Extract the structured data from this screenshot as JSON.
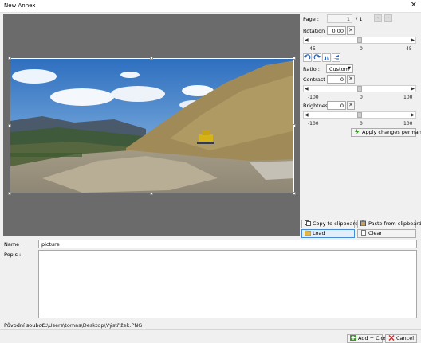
{
  "window": {
    "title": "New Annex",
    "close_glyph": "✕"
  },
  "page": {
    "label": "Page :",
    "current": "1",
    "total": "/ 1",
    "prev": "‹",
    "next": "›"
  },
  "rotation": {
    "label": "Rotation :",
    "value": "0,00",
    "ticks": [
      "-45",
      "0",
      "45"
    ],
    "level": 0
  },
  "transform_icons": [
    "rotate-left-icon",
    "rotate-right-icon",
    "flip-vertical-icon",
    "flip-horizontal-icon"
  ],
  "ratio": {
    "label": "Ratio :",
    "value": "Custom"
  },
  "contrast": {
    "label": "Contrast :",
    "value": "0",
    "ticks": [
      "-100",
      "0",
      "100"
    ],
    "level": 0
  },
  "brightness": {
    "label": "Brightness :",
    "value": "0",
    "ticks": [
      "-100",
      "0",
      "100"
    ],
    "level": 0
  },
  "apply_label": "Apply changes permanently",
  "clip": {
    "copy": "Copy to clipboard",
    "paste": "Paste from clipboard",
    "load": "Load",
    "clear": "Clear"
  },
  "form": {
    "name_label": "Name :",
    "name_value": "picture",
    "popis_label": "Popis :",
    "popis_value": "",
    "source_label": "Původní soubor :",
    "source_value": "C:\\Users\\tomas\\Desktop\\Výstřižek.PNG"
  },
  "footer": {
    "add_close": "Add + Close",
    "cancel": "Cancel"
  },
  "colors": {
    "canvas": "#6b6b6b",
    "apply_icon": "#3a9a2a",
    "cancel_icon": "#d02020",
    "accent": "#4a8bd6"
  }
}
